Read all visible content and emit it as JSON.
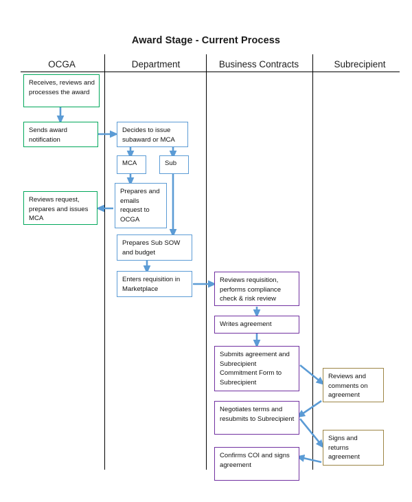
{
  "title": "Award Stage - Current Process",
  "lanes": [
    {
      "id": "ocga",
      "label": "OCGA",
      "color": "#00a75a"
    },
    {
      "id": "dept",
      "label": "Department",
      "color": "#5b9bd5"
    },
    {
      "id": "bc",
      "label": "Business Contracts",
      "color": "#7030a0"
    },
    {
      "id": "sub",
      "label": "Subrecipient",
      "color": "#9c8545"
    }
  ],
  "arrow_color": "#5b9bd5",
  "divider_color": "#000000",
  "nodes": {
    "ocga": [
      {
        "id": "ocga-receives",
        "text": "Receives, reviews and processes the award"
      },
      {
        "id": "ocga-sends",
        "text": "Sends award notification"
      },
      {
        "id": "ocga-reviews",
        "text": "Reviews request, prepares and issues MCA"
      }
    ],
    "dept": [
      {
        "id": "dept-decides",
        "text": "Decides to issue subaward or MCA"
      },
      {
        "id": "dept-mca",
        "text": "MCA"
      },
      {
        "id": "dept-sub",
        "text": "Sub"
      },
      {
        "id": "dept-prepares",
        "text": "Prepares and emails request to OCGA"
      },
      {
        "id": "dept-sow",
        "text": "Prepares Sub SOW and budget"
      },
      {
        "id": "dept-requisit",
        "text": "Enters requisition in Marketplace"
      }
    ],
    "bc": [
      {
        "id": "bc-reviews",
        "text": "Reviews requisition, performs compliance check & risk review"
      },
      {
        "id": "bc-writes",
        "text": "Writes agreement"
      },
      {
        "id": "bc-submits",
        "text": "Submits agreement and Subrecipient Commitment Form to Subrecipient"
      },
      {
        "id": "bc-negotiates",
        "text": "Negotiates terms and resubmits to Subrecipient"
      },
      {
        "id": "bc-confirms",
        "text": "Confirms COI and signs agreement"
      }
    ],
    "sub": [
      {
        "id": "sub-reviews",
        "text": "Reviews and comments on agreement"
      },
      {
        "id": "sub-signs",
        "text": "Signs and returns agreement"
      }
    ]
  }
}
